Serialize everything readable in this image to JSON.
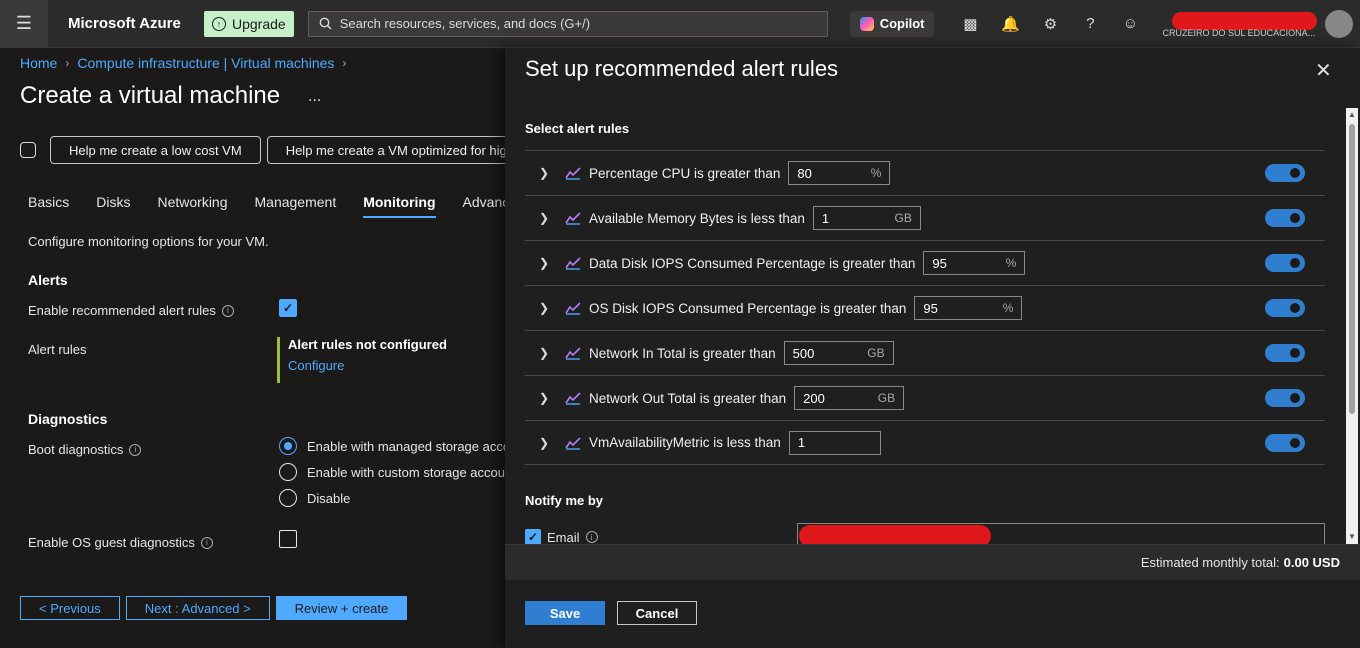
{
  "topbar": {
    "brand": "Microsoft Azure",
    "upgrade": "Upgrade",
    "search_placeholder": "Search resources, services, and docs (G+/)",
    "copilot": "Copilot",
    "org_name": "CRUZEIRO DO SUL EDUCACIONA..."
  },
  "breadcrumb": {
    "home": "Home",
    "parent": "Compute infrastructure | Virtual machines"
  },
  "page": {
    "title": "Create a virtual machine",
    "more": "...",
    "help_buttons": [
      "Help me create a low cost VM",
      "Help me create a VM optimized for hig"
    ],
    "tabs": [
      "Basics",
      "Disks",
      "Networking",
      "Management",
      "Monitoring",
      "Advance"
    ],
    "active_tab": "Monitoring",
    "description": "Configure monitoring options for your VM.",
    "alerts_heading": "Alerts",
    "enable_alerts_label": "Enable recommended alert rules",
    "alert_rules_label": "Alert rules",
    "alert_status": "Alert rules not configured",
    "configure_link": "Configure",
    "diagnostics_heading": "Diagnostics",
    "boot_diag_label": "Boot diagnostics",
    "boot_options": [
      "Enable with managed storage acco",
      "Enable with custom storage accour",
      "Disable"
    ],
    "os_guest_label": "Enable OS guest diagnostics"
  },
  "footer": {
    "previous": "< Previous",
    "next": "Next : Advanced >",
    "review": "Review + create"
  },
  "blade": {
    "title": "Set up recommended alert rules",
    "select_heading": "Select alert rules",
    "rules": [
      {
        "name": "Percentage CPU is greater than",
        "value": "80",
        "unit": "%"
      },
      {
        "name": "Available Memory Bytes is less than",
        "value": "1",
        "unit": "GB"
      },
      {
        "name": "Data Disk IOPS Consumed Percentage is greater than",
        "value": "95",
        "unit": "%"
      },
      {
        "name": "OS Disk IOPS Consumed Percentage is greater than",
        "value": "95",
        "unit": "%"
      },
      {
        "name": "Network In Total is greater than",
        "value": "500",
        "unit": "GB"
      },
      {
        "name": "Network Out Total is greater than",
        "value": "200",
        "unit": "GB"
      },
      {
        "name": "VmAvailabilityMetric is less than",
        "value": "1",
        "unit": ""
      }
    ],
    "notify_heading": "Notify me by",
    "email_label": "Email",
    "estimate_label": "Estimated monthly total:",
    "estimate_value": "0.00 USD",
    "save": "Save",
    "cancel": "Cancel"
  },
  "colors": {
    "accent": "#4fa9ff",
    "toggle_on": "#2f7ed0",
    "upgrade_bg": "#c6f1c8",
    "configured_bar": "#9ac13b"
  }
}
